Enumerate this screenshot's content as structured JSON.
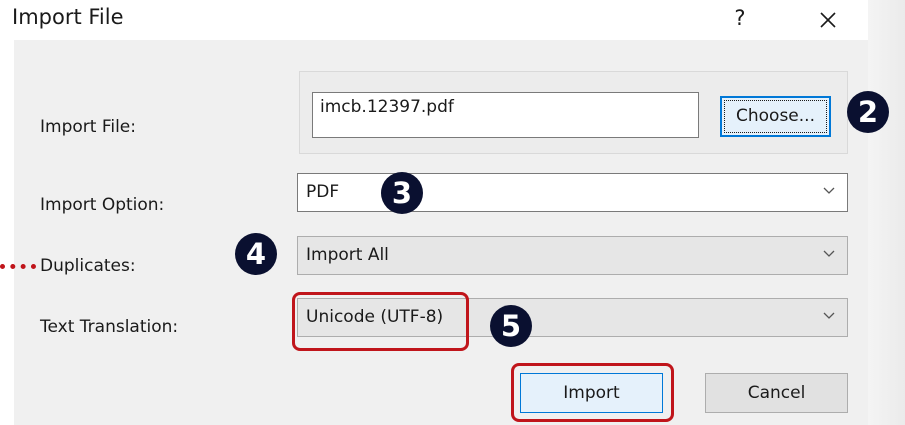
{
  "dialog": {
    "title": "Import File",
    "help_label": "?",
    "close_icon": "close-icon"
  },
  "form": {
    "import_file_label": "Import File:",
    "import_file_value": "imcb.12397.pdf",
    "choose_label": "Choose...",
    "import_option_label": "Import Option:",
    "import_option_value": "PDF",
    "duplicates_label": "Duplicates:",
    "duplicates_value": "Import All",
    "text_translation_label": "Text Translation:",
    "text_translation_value": "Unicode (UTF-8)"
  },
  "buttons": {
    "import_label": "Import",
    "cancel_label": "Cancel"
  },
  "annotations": {
    "marker_2": "2",
    "marker_3": "3",
    "marker_4": "4",
    "marker_5": "5",
    "marker_color": "#0a1030",
    "highlight_color": "#c0151b"
  }
}
